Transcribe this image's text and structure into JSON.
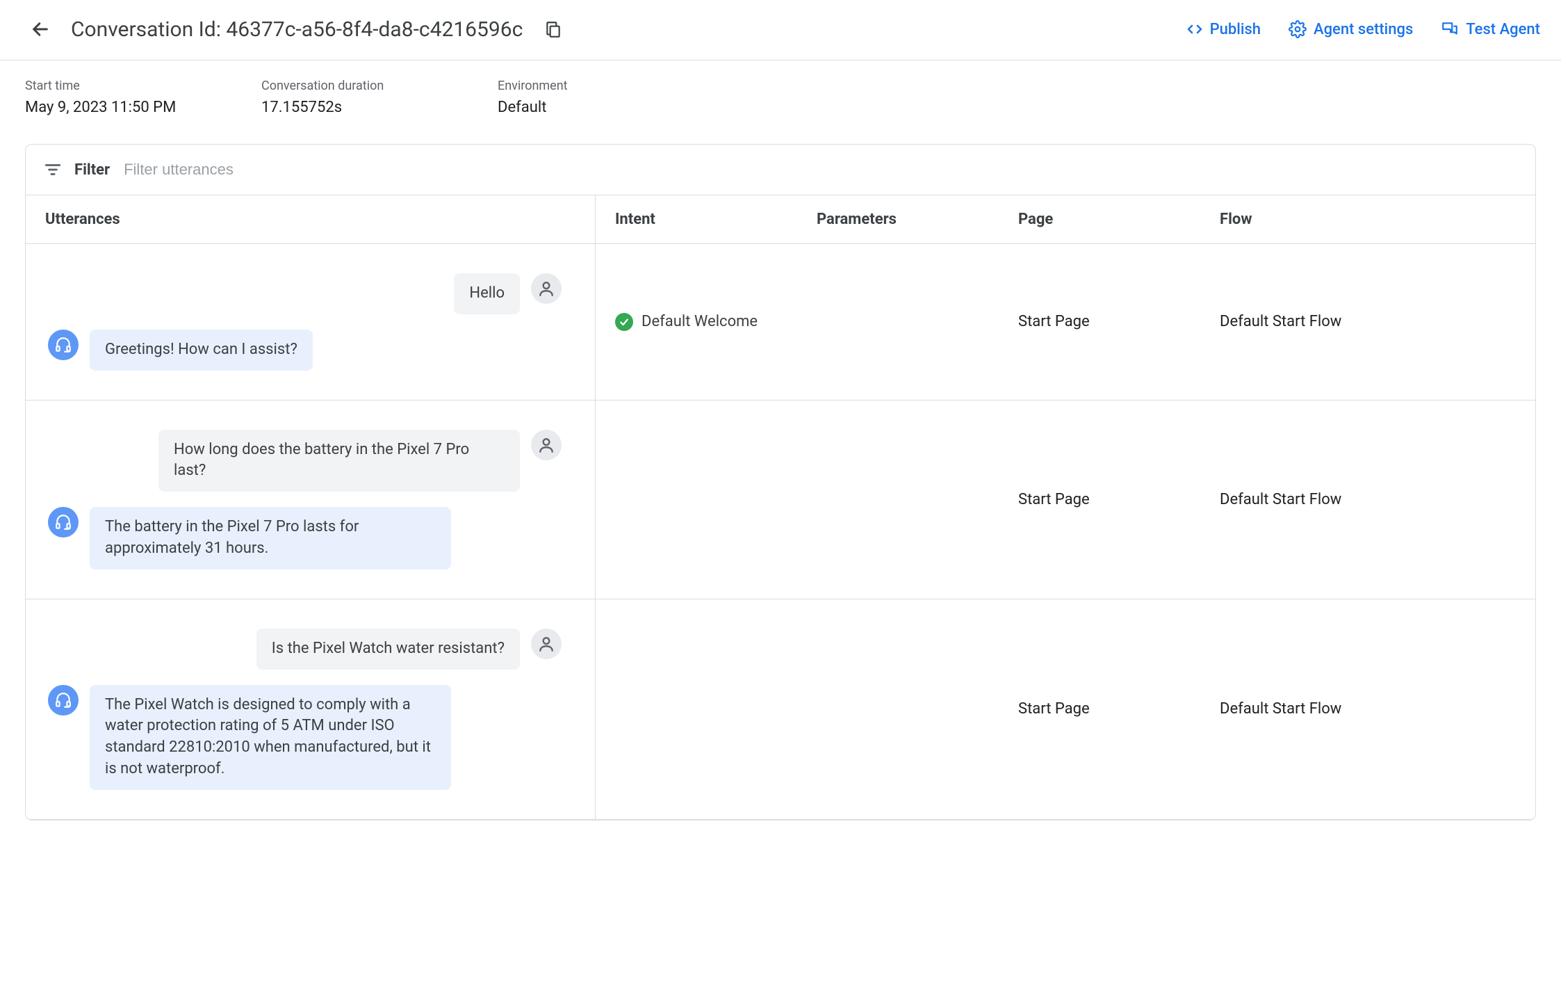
{
  "header": {
    "title": "Conversation Id: 46377c-a56-8f4-da8-c4216596c",
    "actions": {
      "publish": "Publish",
      "agent_settings": "Agent settings",
      "test_agent": "Test Agent"
    }
  },
  "meta": {
    "start_time_label": "Start time",
    "start_time_value": "May 9, 2023 11:50 PM",
    "duration_label": "Conversation duration",
    "duration_value": "17.155752s",
    "environment_label": "Environment",
    "environment_value": "Default"
  },
  "filter": {
    "label": "Filter",
    "placeholder": "Filter utterances"
  },
  "columns": {
    "utterances": "Utterances",
    "intent": "Intent",
    "parameters": "Parameters",
    "page": "Page",
    "flow": "Flow"
  },
  "turns": [
    {
      "user": "Hello",
      "agent": "Greetings! How can I assist?",
      "intent": "Default Welcome",
      "intent_matched": true,
      "parameters": "",
      "page": "Start Page",
      "flow": "Default Start Flow"
    },
    {
      "user": "How long does the battery in the Pixel 7 Pro last?",
      "agent": "The battery in the Pixel 7 Pro lasts for approximately 31 hours.",
      "intent": "",
      "intent_matched": false,
      "parameters": "",
      "page": "Start Page",
      "flow": "Default Start Flow"
    },
    {
      "user": "Is the Pixel Watch water resistant?",
      "agent": "The Pixel Watch is designed to comply with a water protection rating of 5 ATM under ISO standard 22810:2010 when manufactured, but it is not waterproof.",
      "intent": "",
      "intent_matched": false,
      "parameters": "",
      "page": "Start Page",
      "flow": "Default Start Flow"
    }
  ]
}
